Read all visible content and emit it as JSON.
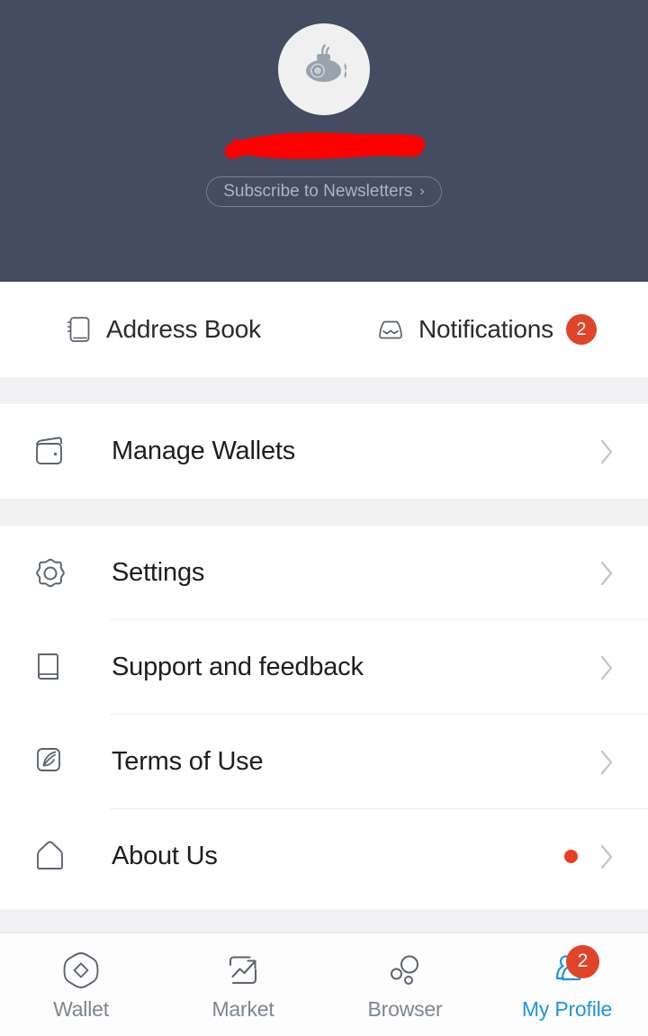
{
  "header": {
    "background_color": "#434c60",
    "avatar_icon": "submarine-avatar-icon",
    "username_redacted": true,
    "redaction_color": "#ff0000",
    "subscribe": {
      "label": "Subscribe to Newsletters",
      "chevron": "›"
    }
  },
  "quick_tabs": [
    {
      "id": "address-book",
      "label": "Address Book",
      "icon": "address-book-icon",
      "badge": null
    },
    {
      "id": "notifications",
      "label": "Notifications",
      "icon": "inbox-icon",
      "badge": "2"
    }
  ],
  "sections": [
    {
      "id": "wallets-section",
      "rows": [
        {
          "id": "manage-wallets",
          "label": "Manage Wallets",
          "icon": "wallet-icon",
          "dot": false,
          "chevron": true
        }
      ]
    },
    {
      "id": "settings-section",
      "rows": [
        {
          "id": "settings",
          "label": "Settings",
          "icon": "gear-icon",
          "dot": false,
          "chevron": true
        },
        {
          "id": "support-and-feedback",
          "label": "Support and feedback",
          "icon": "book-icon",
          "dot": false,
          "chevron": true
        },
        {
          "id": "terms-of-use",
          "label": "Terms of Use",
          "icon": "quill-icon",
          "dot": false,
          "chevron": true
        },
        {
          "id": "about-us",
          "label": "About Us",
          "icon": "home-icon",
          "dot": true,
          "chevron": true
        }
      ]
    }
  ],
  "bottom_nav": {
    "active_color": "#1f96e0",
    "inactive_color": "#7e868f",
    "items": [
      {
        "id": "wallet",
        "label": "Wallet",
        "icon": "octagon-diamond-icon",
        "active": false,
        "badge": null
      },
      {
        "id": "market",
        "label": "Market",
        "icon": "chart-arrow-icon",
        "active": false,
        "badge": null
      },
      {
        "id": "browser",
        "label": "Browser",
        "icon": "bubbles-icon",
        "active": false,
        "badge": null
      },
      {
        "id": "my-profile",
        "label": "My Profile",
        "icon": "people-icon",
        "active": true,
        "badge": "2"
      }
    ]
  },
  "colors": {
    "header_bg": "#434c60",
    "badge_red": "#e0452a",
    "dot_red": "#e8401f",
    "accent_blue": "#1f96e0",
    "section_gap": "#f1f1f3",
    "text_primary": "#1e1e1e"
  }
}
